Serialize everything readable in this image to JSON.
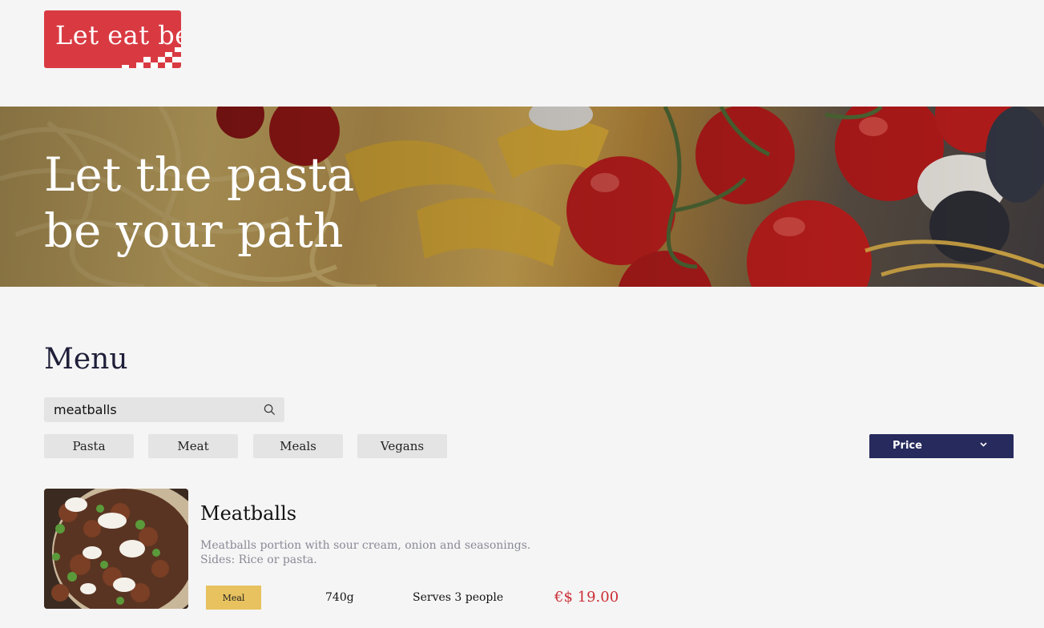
{
  "brand": {
    "logo_text": "Let eat be",
    "logo_color": "#d93a42"
  },
  "hero": {
    "title": "Let the pasta be your path"
  },
  "menu": {
    "title": "Menu",
    "search": {
      "value": "meatballs",
      "icon": "search-icon"
    },
    "categories": [
      {
        "label": "Pasta"
      },
      {
        "label": "Meat"
      },
      {
        "label": "Meals"
      },
      {
        "label": "Vegans"
      }
    ],
    "sort": {
      "label": "Price",
      "icon": "chevron-down-icon",
      "color": "#262a5c"
    },
    "items": [
      {
        "name": "Meatballs",
        "description": "Meatballs portion with sour cream, onion and seasonings. Sides: Rice or pasta.",
        "tag": "Meal",
        "weight": "740g",
        "serves": "Serves 3 people",
        "price": "€$ 19.00"
      }
    ]
  },
  "colors": {
    "accent_red": "#cc2f37",
    "tag_yellow": "#e8c25f",
    "navy": "#262a5c"
  }
}
